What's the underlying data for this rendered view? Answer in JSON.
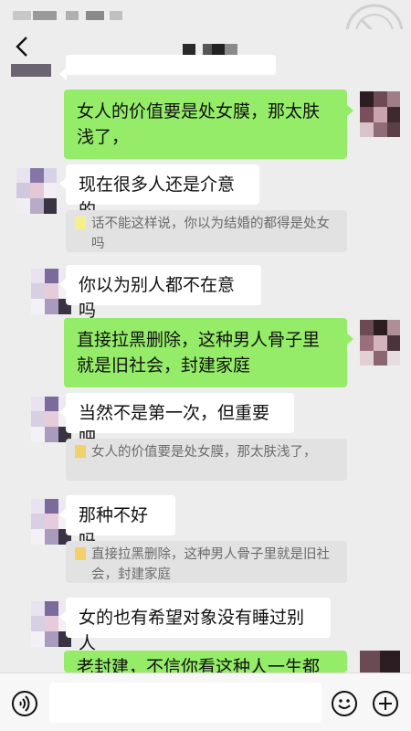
{
  "chat": {
    "messages": [
      {
        "id": "m1",
        "side": "right",
        "text": "女人的价值要是处女膜，那太肤浅了，"
      },
      {
        "id": "m2",
        "side": "left",
        "text": "现在很多人还是介意的",
        "quote": "话不能这样说，你以为结婚的都得是处女吗"
      },
      {
        "id": "m3",
        "side": "left",
        "text": "你以为别人都不在意吗"
      },
      {
        "id": "m4",
        "side": "right",
        "text": "直接拉黑删除，这种男人骨子里就是旧社会，封建家庭"
      },
      {
        "id": "m5",
        "side": "left",
        "text": "当然不是第一次，但重要吧",
        "quote": "女人的价值要是处女膜，那太肤浅了，"
      },
      {
        "id": "m6",
        "side": "left",
        "text": "那种不好吗",
        "quote": "直接拉黑删除，这种男人骨子里就是旧社会，封建家庭"
      },
      {
        "id": "m7",
        "side": "left",
        "text": "女的也有希望对象没有睡过别人"
      },
      {
        "id": "m8",
        "side": "right",
        "text": "老封建，不信你看这种人一生都是"
      }
    ]
  },
  "colors": {
    "background": "#ededed",
    "bubble_self": "#95ec69",
    "bubble_other": "#ffffff",
    "quote_bg": "#e2e2e2"
  },
  "icons": {
    "back": "back-chevron-icon",
    "voice": "voice-icon",
    "emoji": "emoji-icon",
    "more": "plus-icon"
  }
}
